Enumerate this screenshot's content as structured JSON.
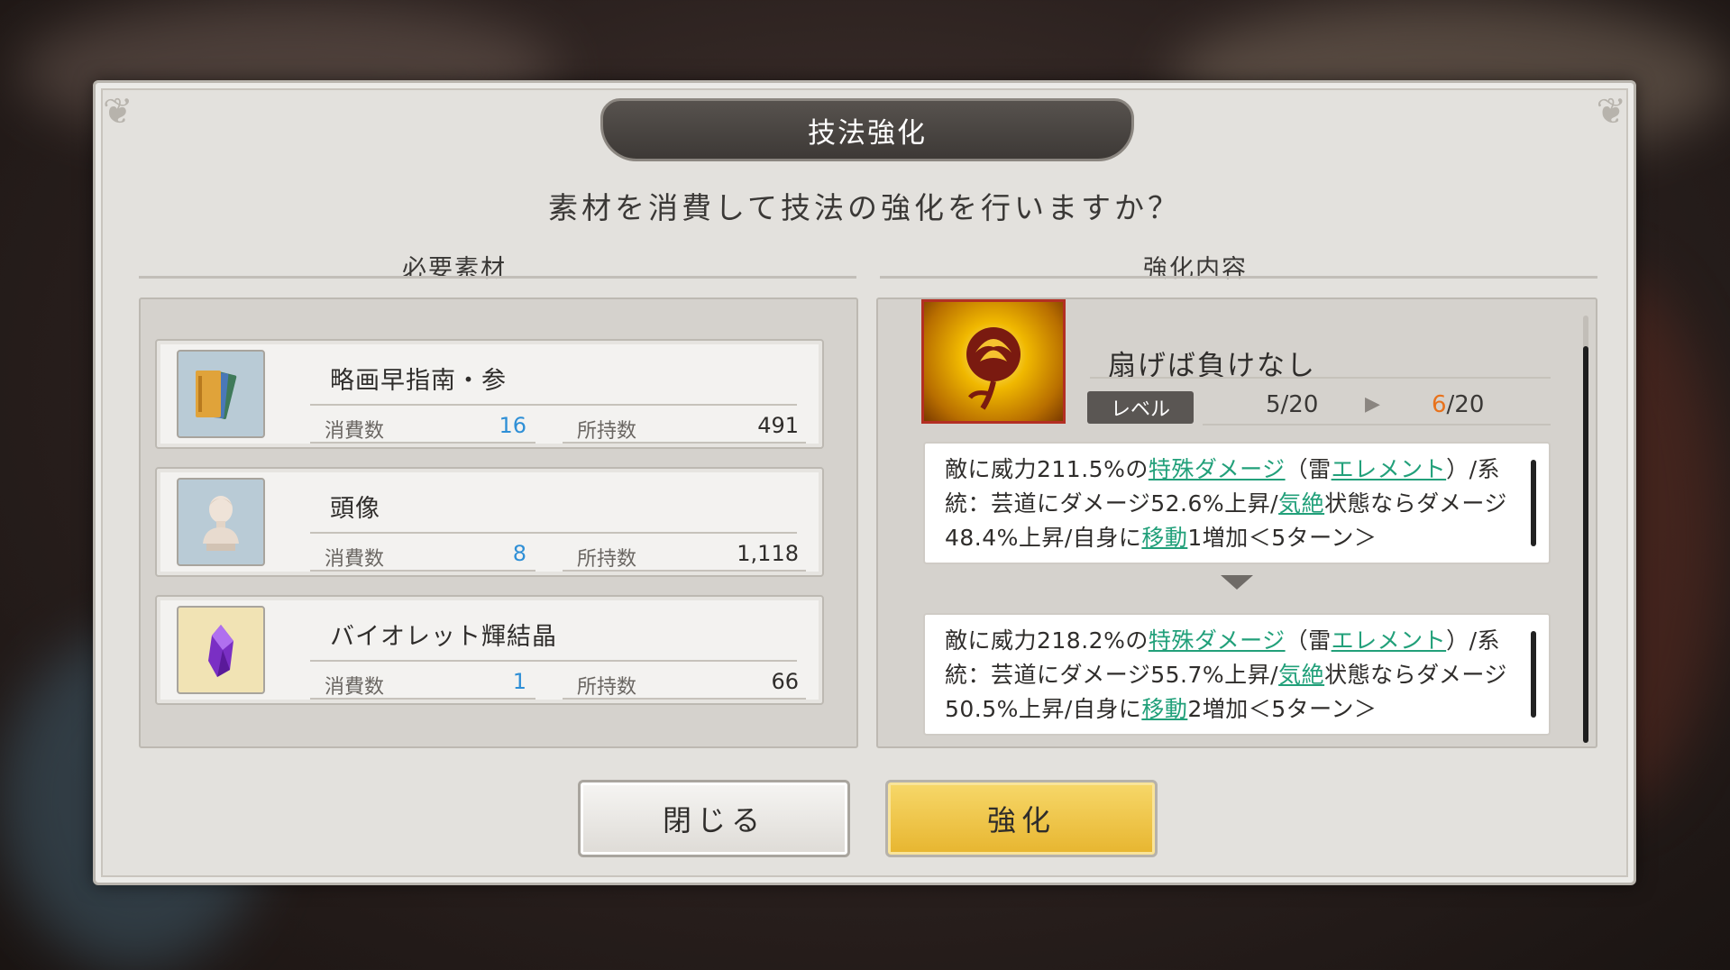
{
  "dialog": {
    "title": "技法強化",
    "question": "素材を消費して技法の強化を行いますか？"
  },
  "materials": {
    "heading": "必要素材",
    "consume_label": "消費数",
    "owned_label": "所持数",
    "items": [
      {
        "name": "略画早指南・参",
        "consume": "16",
        "owned": "491",
        "icon": "books-icon"
      },
      {
        "name": "頭像",
        "consume": "8",
        "owned": "1,118",
        "icon": "bust-statue-icon"
      },
      {
        "name": "バイオレット輝結晶",
        "consume": "1",
        "owned": "66",
        "icon": "violet-crystal-icon"
      }
    ]
  },
  "enhancement": {
    "heading": "強化内容",
    "skill_name": "扇げば負けなし",
    "level_label": "レベル",
    "level_current": "5/20",
    "level_next_num": "6",
    "level_next_max": "/20",
    "current_desc": {
      "p1": "敵に威力211.5%の",
      "k1": "特殊ダメージ",
      "p2": "（雷",
      "k2": "エレメント",
      "p3": "）/系統：芸道にダメージ52.6%上昇/",
      "k3": "気絶",
      "p4": "状態ならダメージ48.4%上昇/自身に",
      "k4": "移動",
      "p5": "1増加＜5ターン＞"
    },
    "next_desc": {
      "p1": "敵に威力218.2%の",
      "k1": "特殊ダメージ",
      "p2": "（雷",
      "k2": "エレメント",
      "p3": "）/系統：芸道にダメージ55.7%上昇/",
      "k3": "気絶",
      "p4": "状態ならダメージ50.5%上昇/自身に",
      "k4": "移動",
      "p5": "2増加＜5ターン＞"
    }
  },
  "buttons": {
    "close": "閉じる",
    "enhance": "強化"
  },
  "colors": {
    "keyword": "#22a07a",
    "consume_value": "#2e8fd6",
    "level_highlight": "#e8721c",
    "enhance_button": "#f2c94a"
  }
}
